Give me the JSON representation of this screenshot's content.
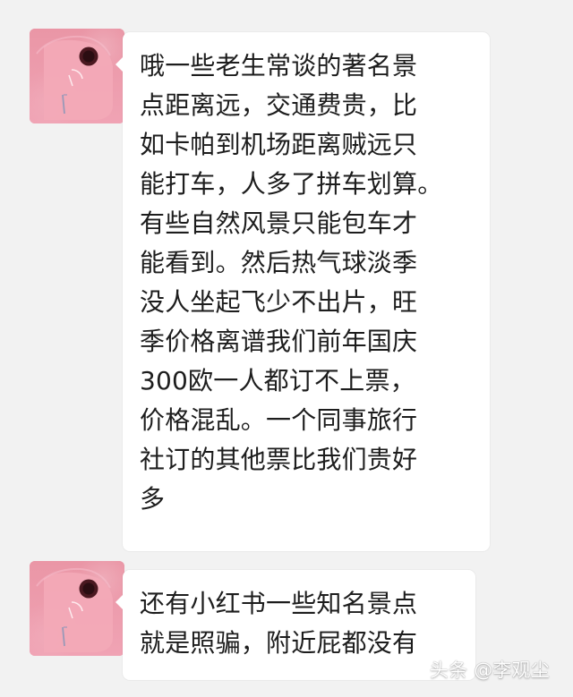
{
  "messages": [
    {
      "text": "哦一些老生常谈的著名景\n点距离远，交通费贵，比\n如卡帕到机场距离贼远只\n能打车，人多了拼车划算。\n有些自然风景只能包车才\n能看到。然后热气球淡季\n没人坐起飞少不出片，旺\n季价格离谱我们前年国庆\n300欧一人都订不上票，\n价格混乱。一个同事旅行\n社订的其他票比我们贵好\n多"
    },
    {
      "text": "还有小红书一些知名景点\n就是照骗，附近屁都没有"
    }
  ],
  "watermark": {
    "text": "头条 @李观尘"
  },
  "colors": {
    "background": "#f2f2f2",
    "bubble": "#ffffff",
    "text": "#1d1d1d",
    "avatar": "#efa0ad"
  }
}
